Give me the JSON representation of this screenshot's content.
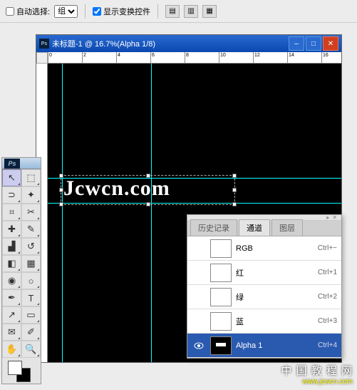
{
  "options_bar": {
    "auto_select_label": "自动选择:",
    "auto_select_checked": false,
    "group_label": "组",
    "show_transform_label": "显示变换控件",
    "show_transform_checked": true
  },
  "document": {
    "title": "未标题-1 @ 16.7%(Alpha 1/8)",
    "ruler_marks": [
      "0",
      "2",
      "4",
      "6",
      "8",
      "10",
      "12",
      "14",
      "16"
    ],
    "canvas_text": "Jcwcn.com"
  },
  "toolbox": {
    "logo": "Ps",
    "tools": [
      {
        "name": "move-tool",
        "glyph": "↖"
      },
      {
        "name": "marquee-tool",
        "glyph": "⬚"
      },
      {
        "name": "lasso-tool",
        "glyph": "⊃"
      },
      {
        "name": "wand-tool",
        "glyph": "✦"
      },
      {
        "name": "crop-tool",
        "glyph": "⌗"
      },
      {
        "name": "slice-tool",
        "glyph": "✂"
      },
      {
        "name": "healing-tool",
        "glyph": "✚"
      },
      {
        "name": "brush-tool",
        "glyph": "✎"
      },
      {
        "name": "stamp-tool",
        "glyph": "▟"
      },
      {
        "name": "history-brush-tool",
        "glyph": "↺"
      },
      {
        "name": "eraser-tool",
        "glyph": "◧"
      },
      {
        "name": "gradient-tool",
        "glyph": "▦"
      },
      {
        "name": "blur-tool",
        "glyph": "◉"
      },
      {
        "name": "dodge-tool",
        "glyph": "○"
      },
      {
        "name": "pen-tool",
        "glyph": "✒"
      },
      {
        "name": "type-tool",
        "glyph": "T"
      },
      {
        "name": "path-tool",
        "glyph": "↗"
      },
      {
        "name": "shape-tool",
        "glyph": "▭"
      },
      {
        "name": "notes-tool",
        "glyph": "✉"
      },
      {
        "name": "eyedropper-tool",
        "glyph": "✐"
      },
      {
        "name": "hand-tool",
        "glyph": "✋"
      },
      {
        "name": "zoom-tool",
        "glyph": "🔍"
      }
    ]
  },
  "channels_panel": {
    "tabs": {
      "history": "历史记录",
      "channels": "通道",
      "layers": "图层"
    },
    "rows": [
      {
        "name": "RGB",
        "shortcut": "Ctrl+~",
        "visible": false,
        "selected": false,
        "thumb": "rgb"
      },
      {
        "name": "红",
        "shortcut": "Ctrl+1",
        "visible": false,
        "selected": false,
        "thumb": "red"
      },
      {
        "name": "绿",
        "shortcut": "Ctrl+2",
        "visible": false,
        "selected": false,
        "thumb": "green"
      },
      {
        "name": "蓝",
        "shortcut": "Ctrl+3",
        "visible": false,
        "selected": false,
        "thumb": "blue"
      },
      {
        "name": "Alpha 1",
        "shortcut": "Ctrl+4",
        "visible": true,
        "selected": true,
        "thumb": "alpha"
      }
    ]
  },
  "watermark": {
    "line1": "中 国 教 程 网",
    "line2": "www.jcwcn.com"
  }
}
